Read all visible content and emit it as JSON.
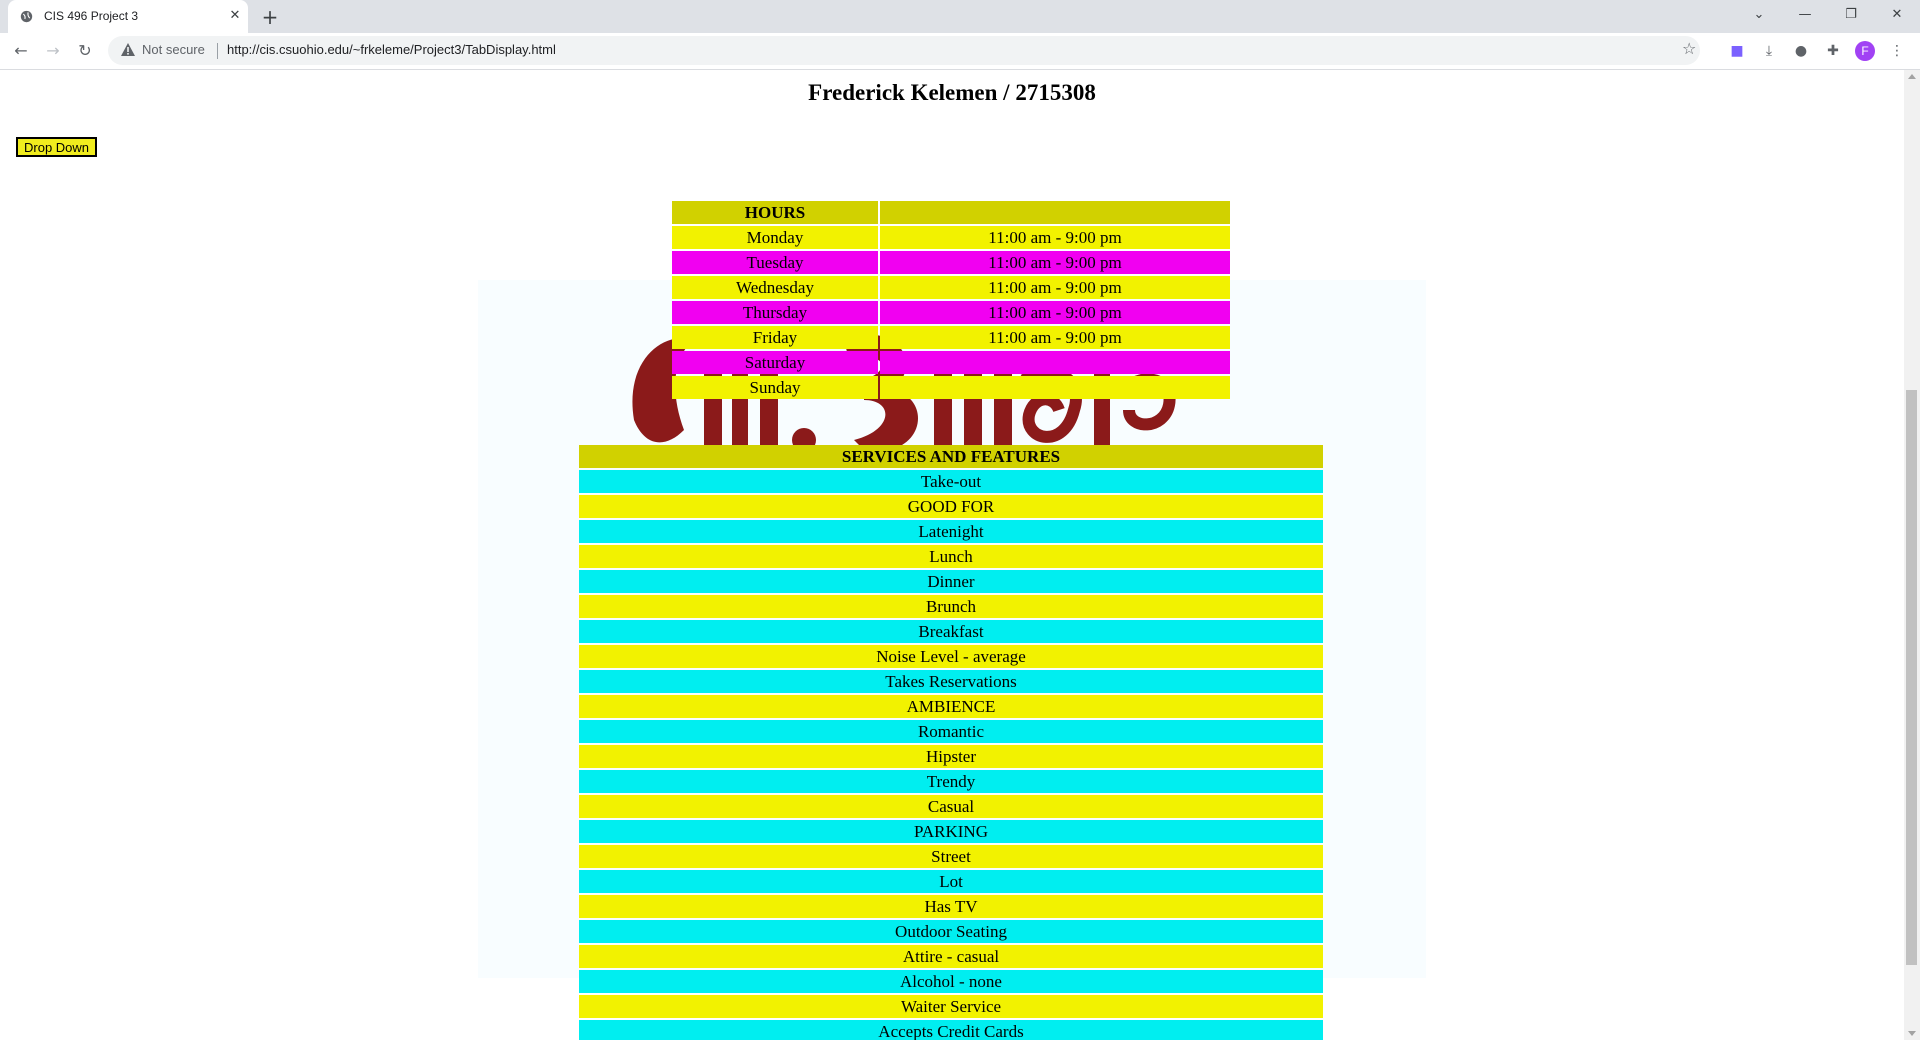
{
  "browser": {
    "tab_title": "CIS 496 Project 3",
    "security_label": "Not secure",
    "url": "http://cis.csuohio.edu/~frkeleme/Project3/TabDisplay.html",
    "profile_initial": "F"
  },
  "page": {
    "title": "Frederick Kelemen / 2715308",
    "dropdown_label": "Drop Down"
  },
  "hours": {
    "header": "HOURS",
    "rows": [
      {
        "day": "Monday",
        "time": "11:00 am - 9:00 pm",
        "color": "#f2f200"
      },
      {
        "day": "Tuesday",
        "time": "11:00 am - 9:00 pm",
        "color": "#f100f1"
      },
      {
        "day": "Wednesday",
        "time": "11:00 am - 9:00 pm",
        "color": "#f2f200"
      },
      {
        "day": "Thursday",
        "time": "11:00 am - 9:00 pm",
        "color": "#f100f1"
      },
      {
        "day": "Friday",
        "time": "11:00 am - 9:00 pm",
        "color": "#f2f200"
      },
      {
        "day": "Saturday",
        "time": "",
        "color": "#f100f1"
      },
      {
        "day": "Sunday",
        "time": "",
        "color": "#f2f200"
      }
    ]
  },
  "services": {
    "header": "SERVICES AND FEATURES",
    "items": [
      "Take-out",
      "GOOD FOR",
      "Latenight",
      "Lunch",
      "Dinner",
      "Brunch",
      "Breakfast",
      "Noise Level - average",
      "Takes Reservations",
      "AMBIENCE",
      "Romantic",
      "Hipster",
      "Trendy",
      "Casual",
      "PARKING",
      "Street",
      "Lot",
      "Has TV",
      "Outdoor Seating",
      "Attire - casual",
      "Alcohol - none",
      "Waiter Service",
      "Accepts Credit Cards"
    ]
  },
  "colors": {
    "header_bg": "#d1d100",
    "yellow": "#f2f200",
    "magenta": "#f100f1",
    "cyan": "#00eef0",
    "logo": "#8b1a1a"
  },
  "icons": {
    "favicon": "globe-icon",
    "warning": "warning-triangle-icon",
    "bookmark": "star-icon",
    "extensions": [
      "teams-icon",
      "download-icon",
      "vpn-icon",
      "puzzle-icon"
    ]
  }
}
